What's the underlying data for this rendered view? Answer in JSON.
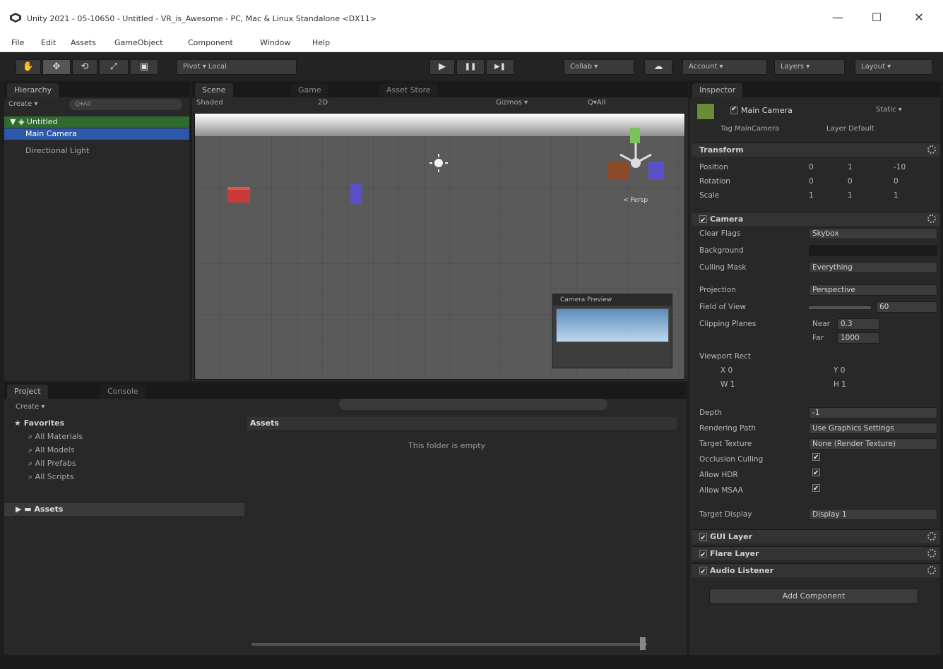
{
  "window": {
    "title": "Unity 2021 - 05-10650 - Untitled - VR_is_Awesome - PC, Mac & Linux Standalone <DX11>",
    "minimize": "—",
    "maximize": "☐",
    "close": "✕"
  },
  "menu": [
    "File",
    "Edit",
    "Assets",
    "GameObject",
    "Component",
    "Window",
    "Help"
  ],
  "toolbar": {
    "tools": [
      "✋",
      "✥",
      "⟲",
      "⤢",
      "▣"
    ],
    "pivot_label": "Pivot  ▾   Local",
    "play": "▶",
    "pause": "❚❚",
    "step": "▶❚",
    "collab_label": "Collab ▾",
    "cloud": "☁",
    "account_label": "Account ▾",
    "layers_label": "Layers ▾",
    "layout_label": "Layout ▾"
  },
  "hierarchy": {
    "tab": "Hierarchy",
    "create_label": "Create ▾",
    "search_placeholder": "Q▾All",
    "scene_name": "Untitled",
    "items": [
      "Main Camera",
      "Directional Light"
    ]
  },
  "scene": {
    "tabs": [
      "Scene",
      "Game",
      "Asset Store"
    ],
    "shading_label": "Shaded",
    "mode_label": "2D",
    "gizmos_label": "Gizmos ▾",
    "all_label": "Q▾All",
    "persp_label": "< Persp",
    "camera_preview_title": "Camera Preview"
  },
  "project": {
    "tabs": [
      "Project",
      "Console"
    ],
    "create_label": "Create ▾",
    "favorites_label": "Favorites",
    "favorites": [
      "All Materials",
      "All Models",
      "All Prefabs",
      "All Scripts"
    ],
    "assets_label": "Assets",
    "breadcrumb": "Assets",
    "empty_message": "This folder is empty"
  },
  "inspector": {
    "tab": "Inspector",
    "object_name": "Main Camera",
    "static_label": "Static ▾",
    "tag_label": "Tag",
    "tag_value": "MainCamera",
    "layer_label": "Layer",
    "layer_value": "Default",
    "transform": {
      "title": "Transform",
      "rows": [
        {
          "label": "Position",
          "x": "0",
          "y": "1",
          "z": "-10"
        },
        {
          "label": "Rotation",
          "x": "0",
          "y": "0",
          "z": "0"
        },
        {
          "label": "Scale",
          "x": "1",
          "y": "1",
          "z": "1"
        }
      ]
    },
    "camera": {
      "title": "Camera",
      "clear_flags_label": "Clear Flags",
      "clear_flags_value": "Skybox",
      "background_label": "Background",
      "culling_mask_label": "Culling Mask",
      "culling_mask_value": "Everything",
      "projection_label": "Projection",
      "projection_value": "Perspective",
      "fov_label": "Field of View",
      "fov_value": "60",
      "clipping_label": "Clipping Planes",
      "near_label": "Near",
      "near_value": "0.3",
      "far_label": "Far",
      "far_value": "1000",
      "viewport_label": "Viewport Rect",
      "vp_x": "X 0",
      "vp_y": "Y 0",
      "vp_w": "W 1",
      "vp_h": "H 1",
      "depth_label": "Depth",
      "depth_value": "-1",
      "rendering_path_label": "Rendering Path",
      "rendering_path_value": "Use Graphics Settings",
      "target_texture_label": "Target Texture",
      "target_texture_value": "None (Render Texture)",
      "occlusion_label": "Occlusion Culling",
      "hdr_label": "Allow HDR",
      "msaa_label": "Allow MSAA",
      "target_display_label": "Target Display",
      "target_display_value": "Display 1"
    },
    "components": [
      "GUI Layer",
      "Flare Layer",
      "Audio Listener"
    ],
    "add_component_label": "Add Component"
  }
}
